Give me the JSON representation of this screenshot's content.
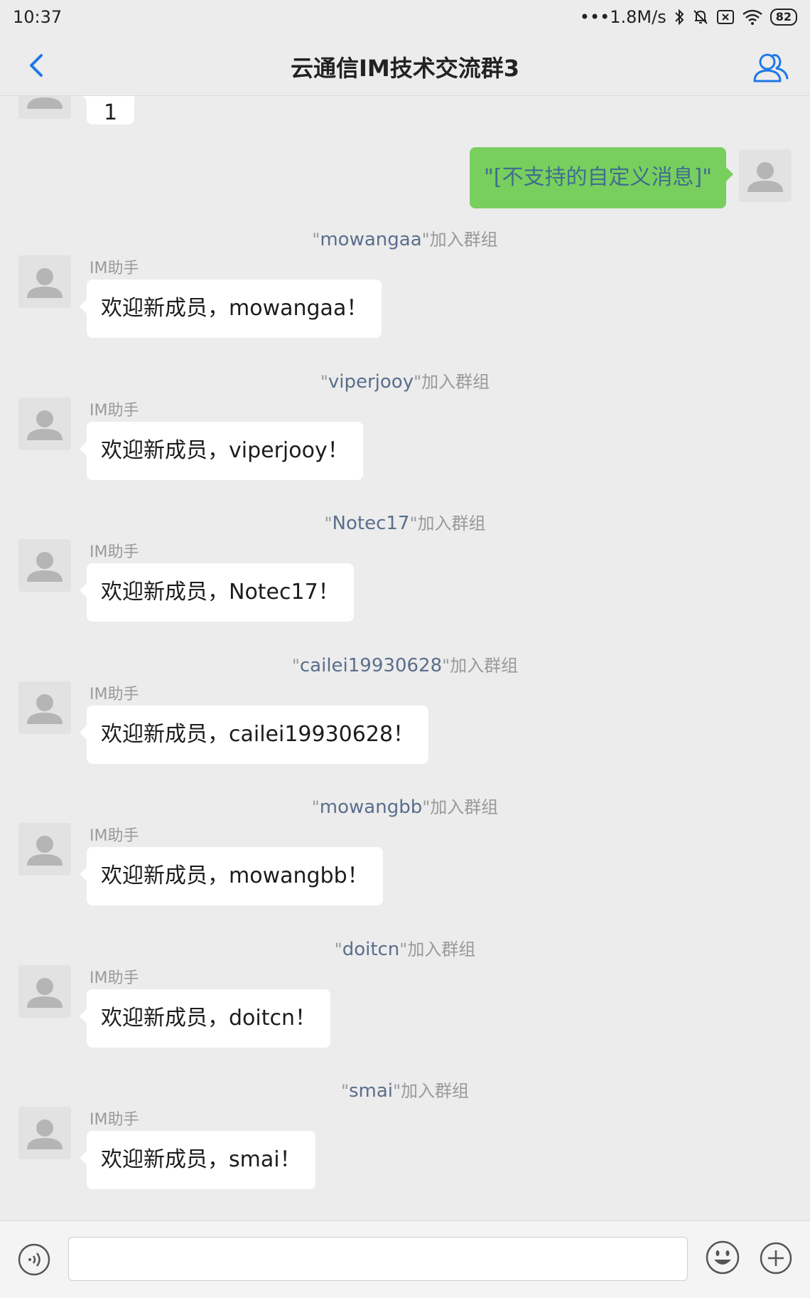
{
  "status_bar": {
    "time": "10:37",
    "speed": "•••1.8M/s",
    "battery": "82",
    "icons": [
      "bluetooth-icon",
      "mute-bell-icon",
      "sim-icon",
      "wifi-icon",
      "battery-icon"
    ]
  },
  "header": {
    "title": "云通信IM技术交流群3",
    "back_icon": "chevron-left-icon",
    "members_icon": "group-members-icon",
    "accent_color": "#1e78e6"
  },
  "messages": {
    "partial_top": {
      "text": "1"
    },
    "outgoing": {
      "text": "\"[不支持的自定义消息]\""
    },
    "groups": [
      {
        "nick": "mowangaa",
        "join_suffix": "\"加入群组",
        "open_quote": "\"",
        "sender": "IM助手",
        "text": "欢迎新成员，mowangaa！"
      },
      {
        "nick": "viperjooy",
        "join_suffix": "\"加入群组",
        "open_quote": "\"",
        "sender": "IM助手",
        "text": "欢迎新成员，viperjooy！"
      },
      {
        "nick": "Notec17",
        "join_suffix": "\"加入群组",
        "open_quote": "\"",
        "sender": "IM助手",
        "text": "欢迎新成员，Notec17！"
      },
      {
        "nick": "cailei19930628",
        "join_suffix": "\"加入群组",
        "open_quote": "\"",
        "sender": "IM助手",
        "text": "欢迎新成员，cailei19930628！"
      },
      {
        "nick": "mowangbb",
        "join_suffix": "\"加入群组",
        "open_quote": "\"",
        "sender": "IM助手",
        "text": "欢迎新成员，mowangbb！"
      },
      {
        "nick": "doitcn",
        "join_suffix": "\"加入群组",
        "open_quote": "\"",
        "sender": "IM助手",
        "text": "欢迎新成员，doitcn！"
      },
      {
        "nick": "smai",
        "join_suffix": "\"加入群组",
        "open_quote": "\"",
        "sender": "IM助手",
        "text": "欢迎新成员，smai！"
      }
    ]
  },
  "input_bar": {
    "value": "",
    "voice_icon": "voice-icon",
    "emoji_icon": "emoji-icon",
    "plus_icon": "plus-icon"
  }
}
